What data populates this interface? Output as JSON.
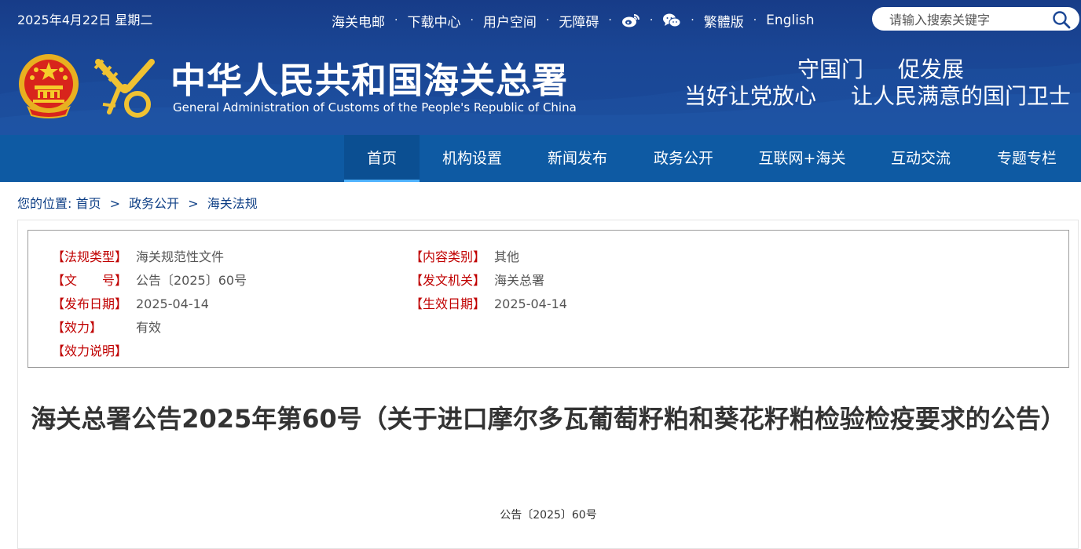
{
  "header": {
    "date": "2025年4月22日 星期二",
    "top_links": [
      "海关电邮",
      "下载中心",
      "用户空间",
      "无障碍"
    ],
    "lang_links": [
      "繁體版",
      "English"
    ],
    "separator": "·",
    "social_icons": [
      "weibo-icon",
      "wechat-icon"
    ],
    "search_placeholder": "请输入搜索关键字",
    "title_cn": "中华人民共和国海关总署",
    "title_en": "General Administration of Customs of the People's Republic of China",
    "slogan_line1": [
      "守国门",
      "促发展"
    ],
    "slogan_line2": [
      "当好让党放心",
      "让人民满意的国门卫士"
    ]
  },
  "nav": {
    "items": [
      "首页",
      "机构设置",
      "新闻发布",
      "政务公开",
      "互联网+海关",
      "互动交流",
      "专题专栏"
    ],
    "active": "首页"
  },
  "breadcrumb": {
    "prefix": "您的位置:",
    "items": [
      "首页",
      "政务公开",
      "海关法规"
    ],
    "separator": ">"
  },
  "meta": {
    "law_type_label": "【法规类型】",
    "law_type": "海关规范性文件",
    "content_type_label": "【内容类别】",
    "content_type": "其他",
    "doc_no_label": "【文　　号】",
    "doc_no": "公告〔2025〕60号",
    "issuer_label": "【发文机关】",
    "issuer": "海关总署",
    "pub_date_label": "【发布日期】",
    "pub_date": "2025-04-14",
    "eff_date_label": "【生效日期】",
    "eff_date": "2025-04-14",
    "validity_label": "【效力】",
    "validity": "有效",
    "validity_note_label": "【效力说明】",
    "validity_note": ""
  },
  "article": {
    "title": "海关总署公告2025年第60号（关于进口摩尔多瓦葡萄籽粕和葵花籽粕检验检疫要求的公告）",
    "doc_number": "公告〔2025〕60号"
  },
  "colors": {
    "header_bg": "#1a4695",
    "nav_bg": "#0e5aa3",
    "label_red": "#c00000",
    "breadcrumb_text": "#0e3f86"
  }
}
